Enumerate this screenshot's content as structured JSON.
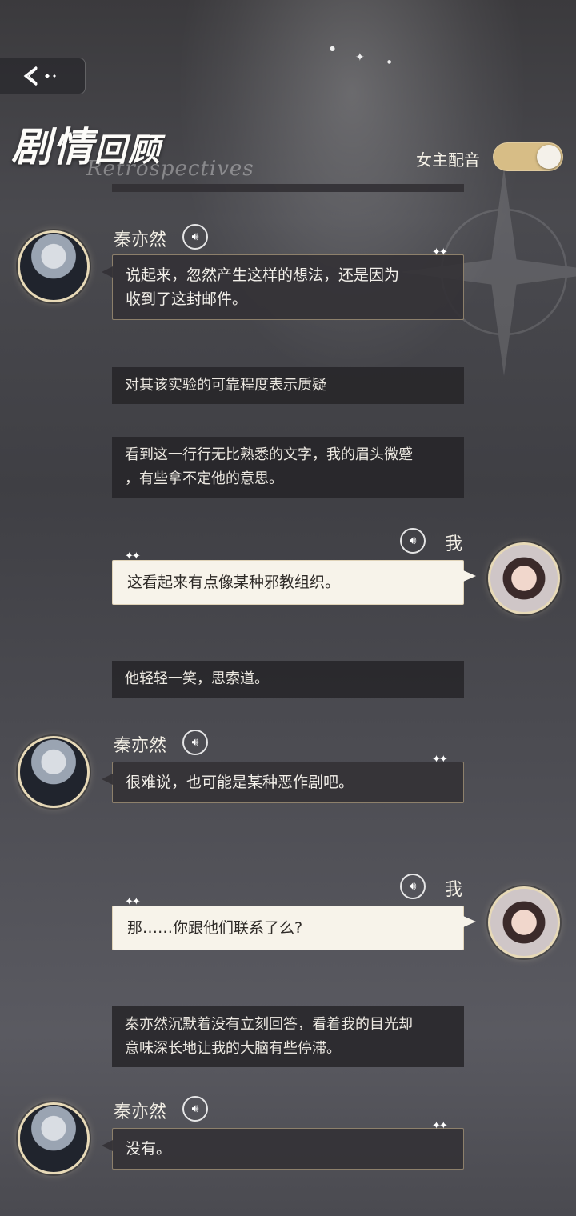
{
  "header": {
    "back_icon": "back-arrow-sparkle-icon",
    "title_big": "剧情",
    "title_small": "回顾",
    "subtitle": "Retrospectives",
    "voice_toggle_label": "女主配音",
    "voice_toggle_on": true
  },
  "colors": {
    "toggle_on": "#d7bd86",
    "bubble_player": "#f7f3ea",
    "bubble_npc": "#343236",
    "narration_bg": "#262428"
  },
  "messages": [
    {
      "type": "npc",
      "speaker": "秦亦然",
      "voice_icon": "voice-play-icon",
      "lines": [
        "说起来，忽然产生这样的想法，还是因为",
        "收到了这封邮件。"
      ]
    },
    {
      "type": "narration",
      "lines": [
        "对其该实验的可靠程度表示质疑"
      ]
    },
    {
      "type": "narration",
      "lines": [
        "看到这一行行无比熟悉的文字，我的眉头微蹙",
        "，有些拿不定他的意思。"
      ]
    },
    {
      "type": "player",
      "speaker": "我",
      "voice_icon": "voice-play-icon",
      "lines": [
        "这看起来有点像某种邪教组织。"
      ]
    },
    {
      "type": "narration",
      "lines": [
        "他轻轻一笑，思索道。"
      ]
    },
    {
      "type": "npc",
      "speaker": "秦亦然",
      "voice_icon": "voice-play-icon",
      "lines": [
        "很难说，也可能是某种恶作剧吧。"
      ]
    },
    {
      "type": "player",
      "speaker": "我",
      "voice_icon": "voice-play-icon",
      "lines": [
        "那……你跟他们联系了么?"
      ]
    },
    {
      "type": "narration",
      "lines": [
        "秦亦然沉默着没有立刻回答，看着我的目光却",
        "意味深长地让我的大脑有些停滞。"
      ]
    },
    {
      "type": "npc",
      "speaker": "秦亦然",
      "voice_icon": "voice-play-icon",
      "lines": [
        "没有。"
      ]
    }
  ]
}
